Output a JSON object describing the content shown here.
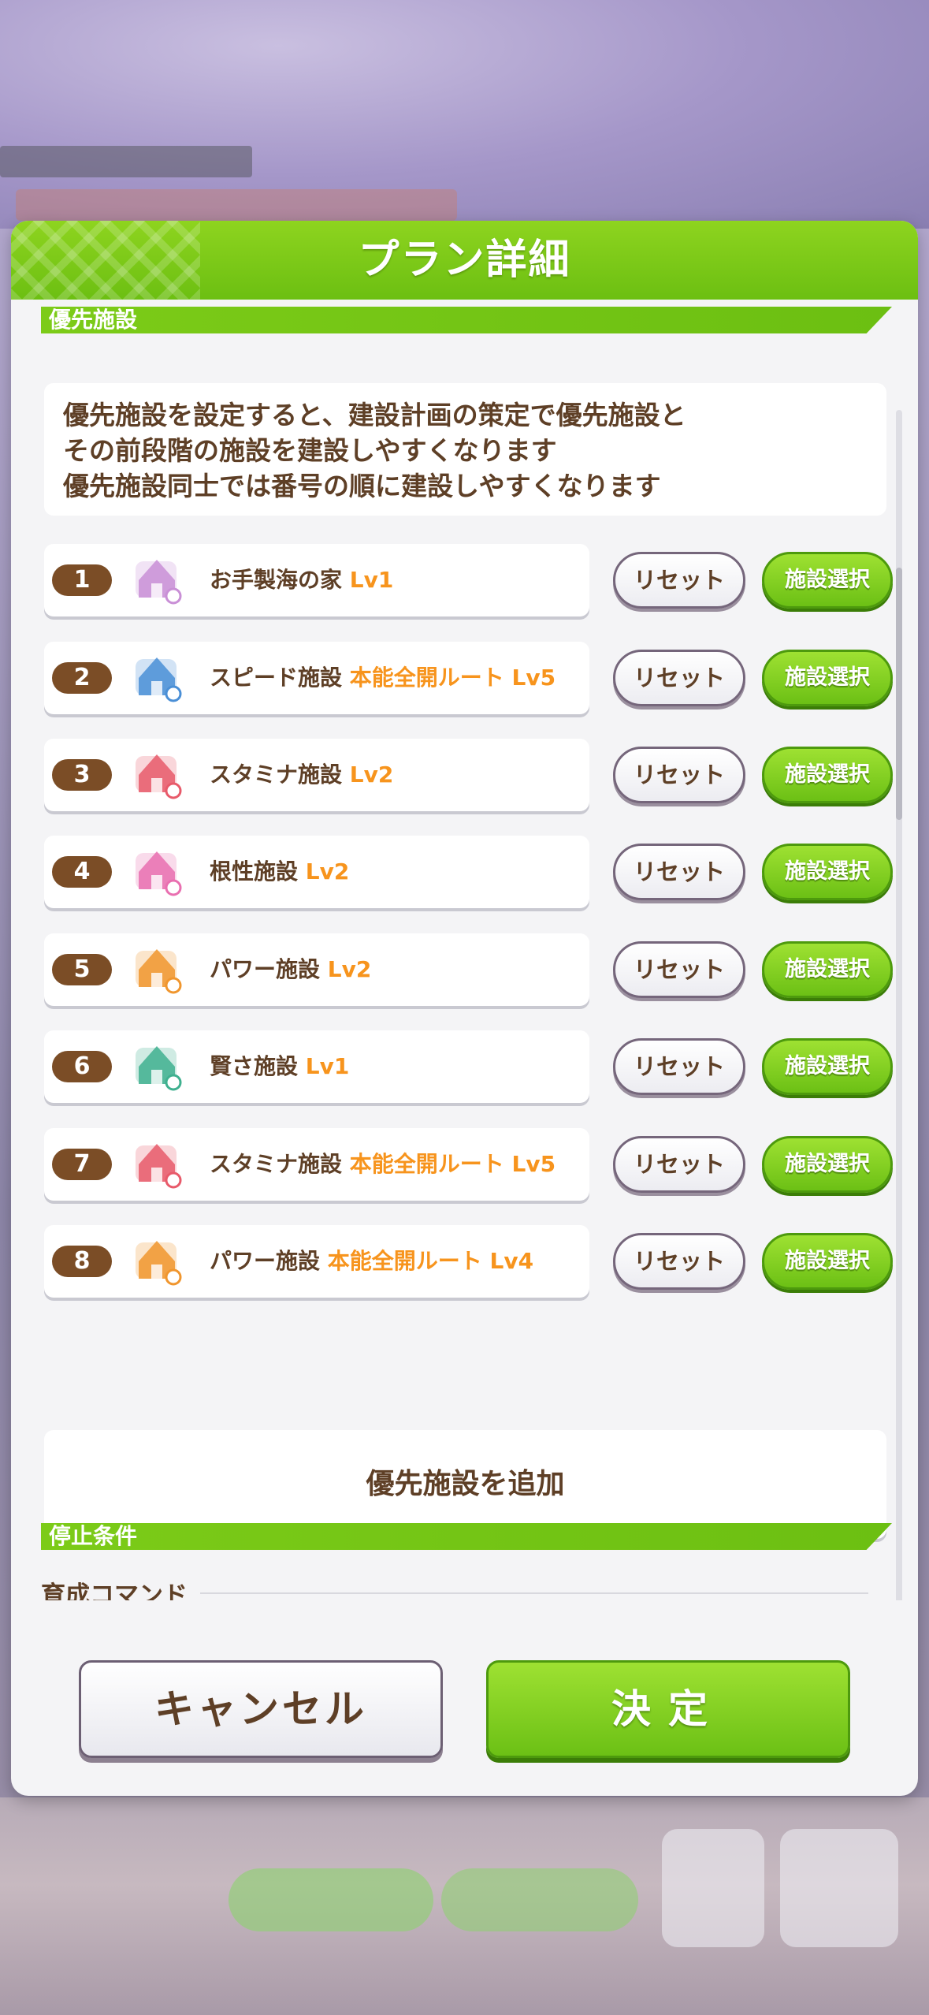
{
  "dialog": {
    "title": "プラン詳細"
  },
  "priority_section": {
    "label": "優先施設",
    "description": [
      "優先施設を設定すると、建設計画の策定で優先施設と",
      "その前段階の施設を建設しやすくなります",
      "優先施設同士では番号の順に建設しやすくなります"
    ],
    "rows": [
      {
        "num": "1",
        "name": "お手製海の家",
        "level": "Lv1",
        "icon": "beach-house-icon",
        "icon_color": "#c98fd6"
      },
      {
        "num": "2",
        "name": "スピード施設",
        "level": "本能全開ルート Lv5",
        "icon": "speed-facility-icon",
        "icon_color": "#4a8fd6"
      },
      {
        "num": "3",
        "name": "スタミナ施設",
        "level": "Lv2",
        "icon": "stamina-facility-icon",
        "icon_color": "#e85a6a"
      },
      {
        "num": "4",
        "name": "根性施設",
        "level": "Lv2",
        "icon": "guts-facility-icon",
        "icon_color": "#e96fb0"
      },
      {
        "num": "5",
        "name": "パワー施設",
        "level": "Lv2",
        "icon": "power-facility-icon",
        "icon_color": "#f0962e"
      },
      {
        "num": "6",
        "name": "賢さ施設",
        "level": "Lv1",
        "icon": "wisdom-facility-icon",
        "icon_color": "#3fb08f"
      },
      {
        "num": "7",
        "name": "スタミナ施設",
        "level": "本能全開ルート Lv5",
        "icon": "stamina-facility-icon",
        "icon_color": "#e85a6a"
      },
      {
        "num": "8",
        "name": "パワー施設",
        "level": "本能全開ルート Lv4",
        "icon": "power-facility-icon",
        "icon_color": "#f0962e"
      }
    ],
    "reset_label": "リセット",
    "select_label": "施設選択",
    "add_label": "優先施設を追加"
  },
  "stop_section": {
    "label": "停止条件",
    "sub_label": "育成コマンド"
  },
  "footer": {
    "cancel_label": "キャンセル",
    "confirm_label": "決定"
  },
  "colors": {
    "accent_green": "#6cbf12",
    "text_brown": "#5e3f26",
    "level_orange": "#f7941d"
  }
}
